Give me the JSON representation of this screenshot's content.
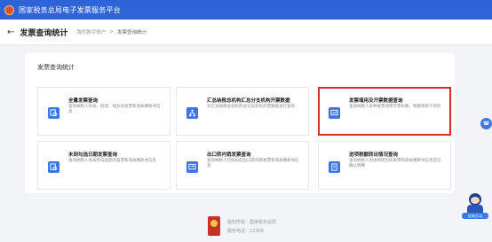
{
  "app": {
    "title": "国家税务总局电子发票服务平台"
  },
  "header": {
    "back_icon": "arrow-left-icon",
    "page_title": "发票查询统计",
    "breadcrumb": [
      "我的数字账户",
      "发票查询统计"
    ],
    "breadcrumb_sep": ">"
  },
  "panel": {
    "title": "发票查询统计",
    "cards": [
      {
        "title": "全量发票查询",
        "desc": "查询纳税人开具、取得、经办的发票和海关缴款书信息",
        "icon": "search-document-icon",
        "selected": false
      },
      {
        "title": "汇总纳税总机构汇总分支机构开票数据",
        "desc": "对汇总纳税总机构的总分支机构开票数据进行查询",
        "icon": "branch-network-icon",
        "selected": false
      },
      {
        "title": "发票填用及开票数据查询",
        "desc": "查询纳税人各种发票领用开票份数、税额等统计资料",
        "icon": "chart-screen-icon",
        "selected": true
      },
      {
        "title": "未到勾选日期发票查询",
        "desc": "查询纳税人尚未到勾选期的发票和海关缴款书信息",
        "icon": "search-document-icon",
        "selected": false
      },
      {
        "title": "出口转内销发票查询",
        "desc": "查询纳税人可抵扣的出口转内销发票和海关缴款书信息",
        "icon": "transfer-screen-icon",
        "selected": false
      },
      {
        "title": "进项税额转出情况查询",
        "desc": "查询纳税人的进项转出的发票和海关缴款书信息及已确认明细",
        "icon": "document-icon",
        "selected": false
      }
    ]
  },
  "footer": {
    "line1": "版权所有：国家税务总局",
    "line2": "服务电话：12366"
  },
  "assistant": {
    "label": "征纳互动"
  },
  "colors": {
    "topbar": "#2f63d8",
    "accent": "#3b76e5",
    "selected_border": "#d72c2c"
  }
}
